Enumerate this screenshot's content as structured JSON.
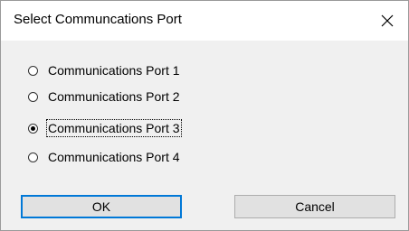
{
  "dialog": {
    "title": "Select Communcations Port",
    "close_glyph": "✕"
  },
  "options": [
    {
      "label": "Communications Port 1",
      "checked": false
    },
    {
      "label": "Communications Port 2",
      "checked": false
    },
    {
      "label": "Communications Port 3",
      "checked": true
    },
    {
      "label": "Communications Port 4",
      "checked": false
    }
  ],
  "buttons": {
    "ok": "OK",
    "cancel": "Cancel"
  }
}
